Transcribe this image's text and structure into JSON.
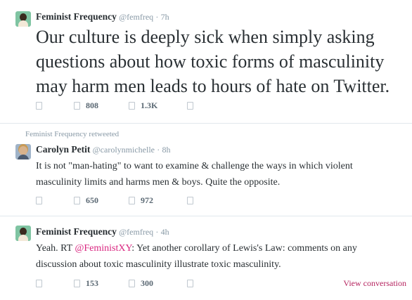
{
  "tweets": [
    {
      "name": "Feminist Frequency",
      "handle": "@femfreq",
      "dot": "·",
      "time": "7h",
      "text": "Our culture is deeply sick when simply asking questions about how toxic forms of masculinity may harm men leads to hours of hate on Twitter.",
      "retweets": "808",
      "favorites": "1.3K"
    },
    {
      "retweeted_by": "Feminist Frequency retweeted",
      "name": "Carolyn Petit",
      "handle": "@carolynmichelle",
      "dot": "·",
      "time": "8h",
      "text": "It is not \"man-hating\" to want to examine & challenge the ways in which violent masculinity limits and harms men & boys. Quite the opposite.",
      "retweets": "650",
      "favorites": "972"
    },
    {
      "name": "Feminist Frequency",
      "handle": "@femfreq",
      "dot": "·",
      "time": "4h",
      "text_prefix": "Yeah. RT ",
      "mention": "@FeministXY",
      "text_suffix": ": Yet another corollary of Lewis's Law: comments on any discussion about toxic masculinity illustrate toxic masculinity.",
      "retweets": "153",
      "favorites": "300",
      "view_conversation": "View conversation"
    }
  ],
  "icons": [
    "reply-icon",
    "retweet-icon",
    "favorite-icon",
    "more-icon"
  ]
}
